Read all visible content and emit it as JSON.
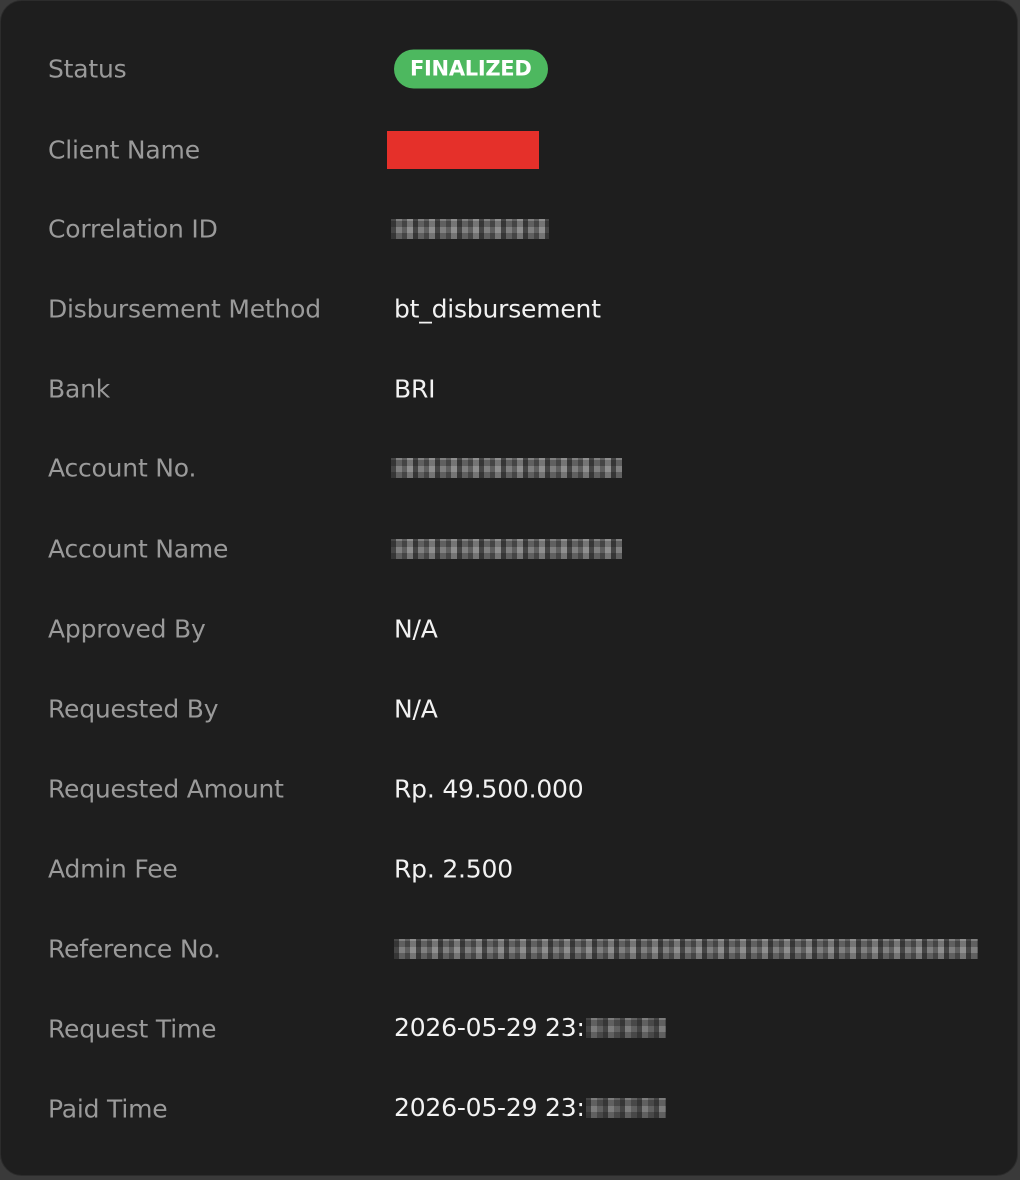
{
  "fields": {
    "status": {
      "label": "Status",
      "value": "FINALIZED",
      "color": "#4db85f"
    },
    "client_name": {
      "label": "Client Name",
      "redaction_color": "#e5302a"
    },
    "correlation_id": {
      "label": "Correlation ID"
    },
    "disbursement_method": {
      "label": "Disbursement Method",
      "value": "bt_disbursement"
    },
    "bank": {
      "label": "Bank",
      "value": "BRI"
    },
    "account_no": {
      "label": "Account No."
    },
    "account_name": {
      "label": "Account Name"
    },
    "approved_by": {
      "label": "Approved By",
      "value": "N/A"
    },
    "requested_by": {
      "label": "Requested By",
      "value": "N/A"
    },
    "requested_amount": {
      "label": "Requested Amount",
      "value": "Rp. 49.500.000"
    },
    "admin_fee": {
      "label": "Admin Fee",
      "value": "Rp. 2.500"
    },
    "reference_no": {
      "label": "Reference No."
    },
    "request_time": {
      "label": "Request Time",
      "value": "2026-05-29 23:"
    },
    "paid_time": {
      "label": "Paid Time",
      "value": "2026-05-29 23:"
    }
  }
}
